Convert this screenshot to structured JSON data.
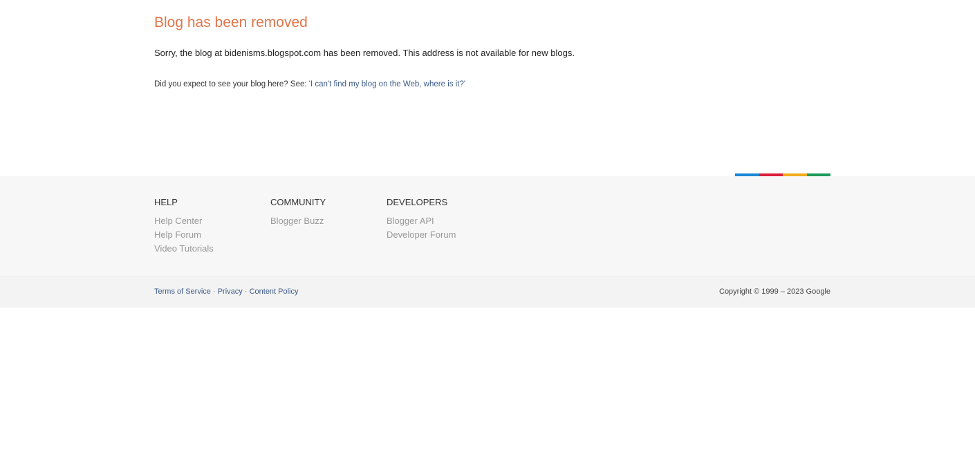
{
  "title": "Blog has been removed",
  "message": "Sorry, the blog at bidenisms.blogspot.com has been removed. This address is not available for new blogs.",
  "help_prefix": "Did you expect to see your blog here? See: ",
  "help_link": "'I can't find my blog on the Web, where is it?'",
  "colors": [
    "#1a88d4",
    "#dd1f3b",
    "#f0ac1c",
    "#1d9b5a"
  ],
  "footer": {
    "columns": [
      {
        "heading": "HELP",
        "links": [
          "Help Center",
          "Help Forum",
          "Video Tutorials"
        ]
      },
      {
        "heading": "COMMUNITY",
        "links": [
          "Blogger Buzz"
        ]
      },
      {
        "heading": "DEVELOPERS",
        "links": [
          "Blogger API",
          "Developer Forum"
        ]
      }
    ],
    "legal": [
      "Terms of Service",
      "Privacy",
      "Content Policy"
    ],
    "separator": "·",
    "copyright": "Copyright © 1999 – 2023 Google"
  }
}
